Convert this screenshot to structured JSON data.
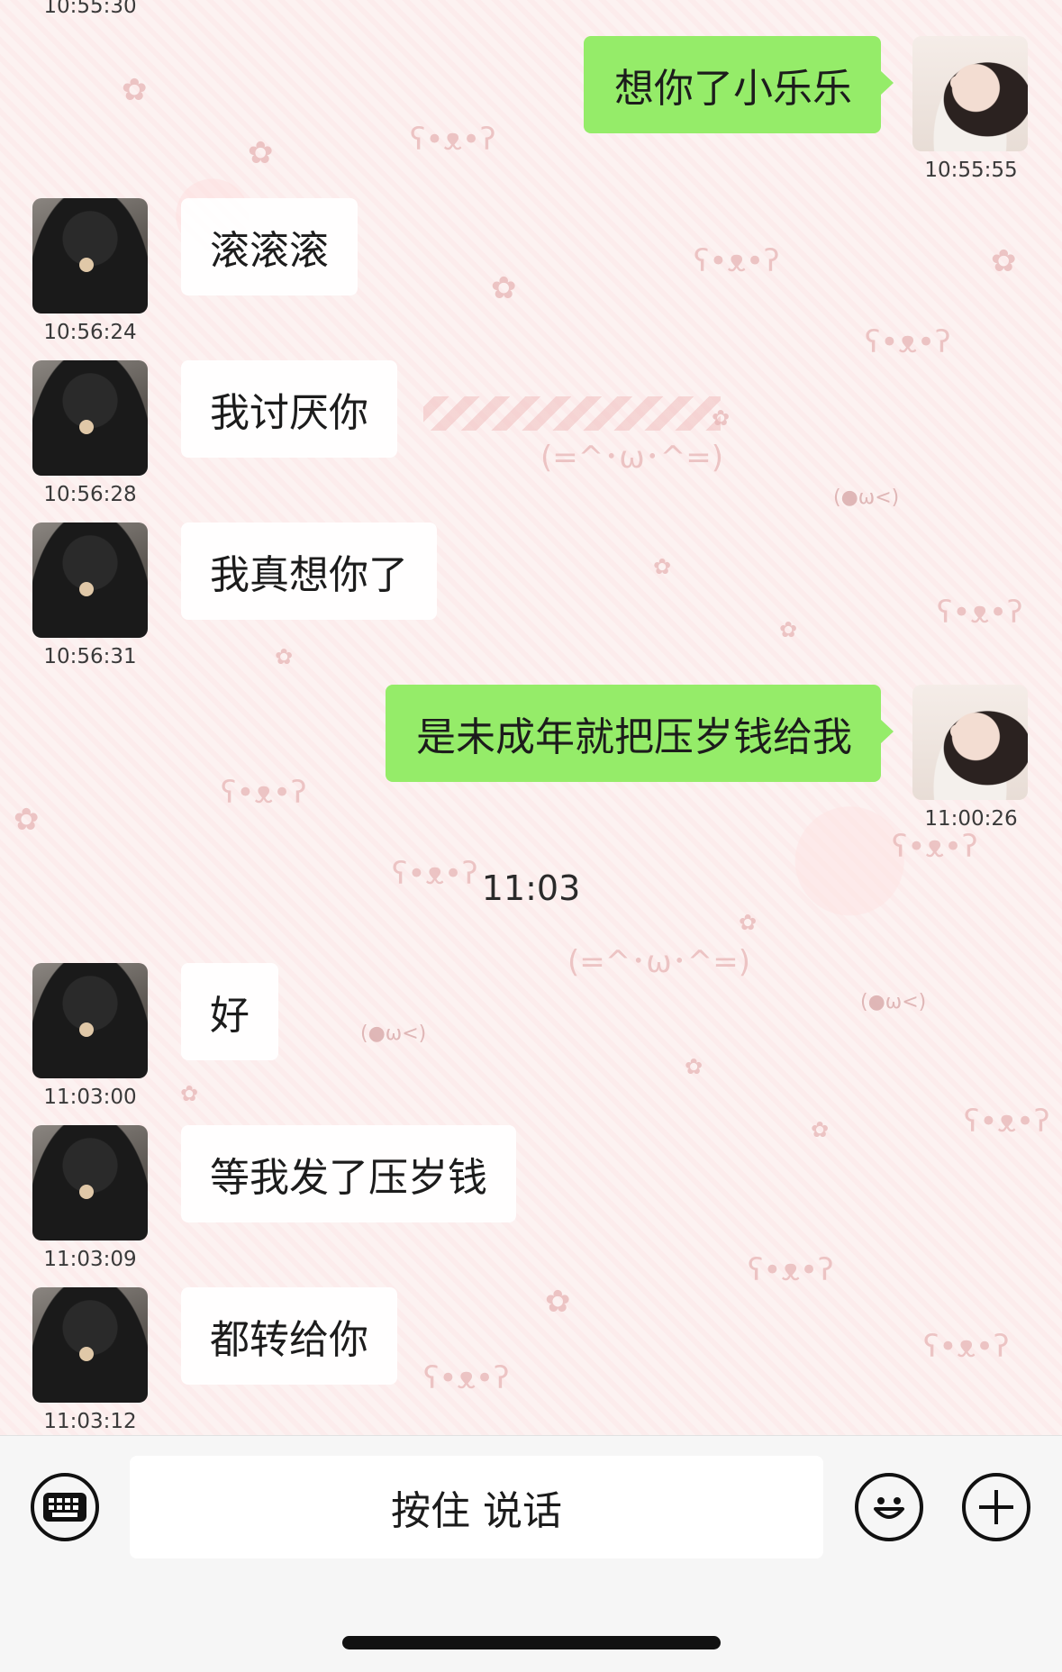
{
  "messages": [
    {
      "side": "right",
      "text": "想你了小乐乐",
      "time": "10:55:55"
    },
    {
      "side": "left",
      "text": "滚滚滚",
      "time": "10:56:24"
    },
    {
      "side": "left",
      "text": "我讨厌你",
      "time": "10:56:28"
    },
    {
      "side": "left",
      "text": "我真想你了",
      "time": "10:56:31"
    },
    {
      "side": "right",
      "text": "是未成年就把压岁钱给我",
      "time": "11:00:26"
    },
    {
      "side": "left",
      "text": "好",
      "time": "11:03:00"
    },
    {
      "side": "left",
      "text": "等我发了压岁钱",
      "time": "11:03:09"
    },
    {
      "side": "left",
      "text": "都转给你",
      "time": "11:03:12"
    }
  ],
  "top_partial_time": "10:55:30",
  "center_time": "11:03",
  "input_bar": {
    "voice_label": "按住 说话"
  },
  "icons": {
    "keyboard": "keyboard-icon",
    "emoji": "emoji-icon",
    "plus": "plus-icon"
  },
  "colors": {
    "my_bubble": "#95ec69",
    "their_bubble": "#ffffff",
    "background": "#fbf0ef"
  }
}
